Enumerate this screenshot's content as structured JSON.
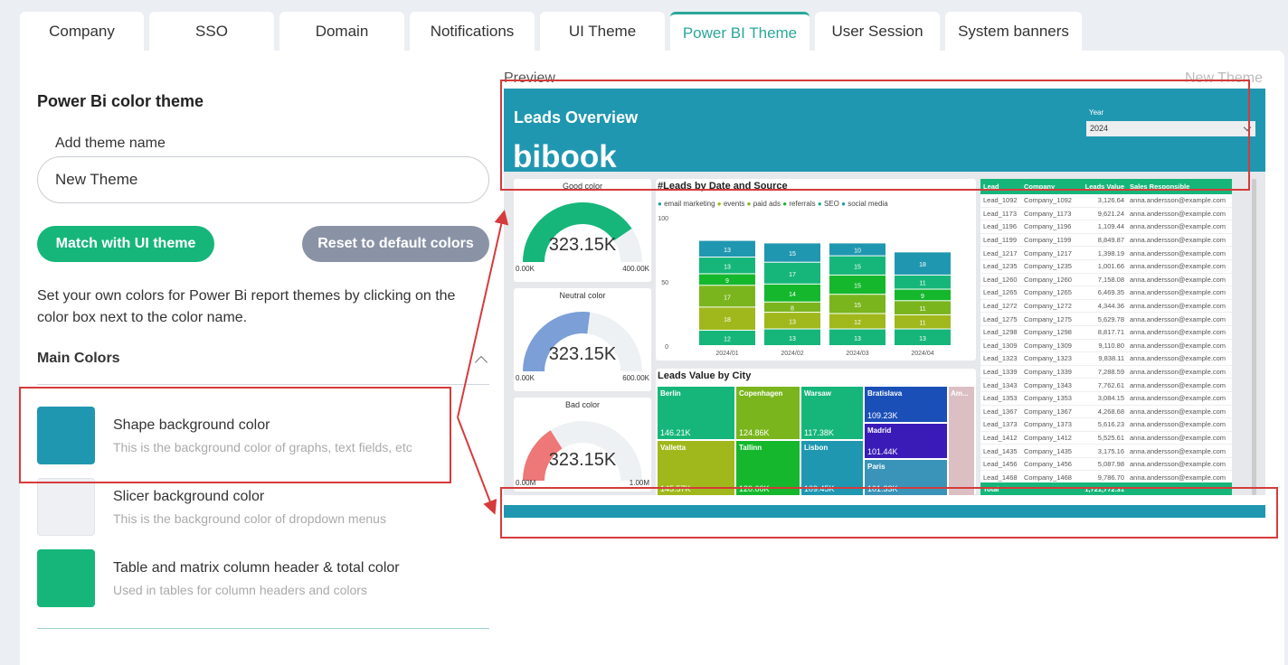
{
  "tabs": [
    {
      "label": "Company"
    },
    {
      "label": "SSO"
    },
    {
      "label": "Domain"
    },
    {
      "label": "Notifications"
    },
    {
      "label": "UI Theme"
    },
    {
      "label": "Power BI Theme"
    },
    {
      "label": "User Session"
    },
    {
      "label": "System banners"
    }
  ],
  "settings": {
    "title": "Power Bi color theme",
    "theme_name_label": "Add theme name",
    "theme_name_value": "New Theme",
    "match_button": "Match with UI theme",
    "reset_button": "Reset to default colors",
    "description": "Set your own colors for Power Bi report themes by clicking on the color box next to the color name.",
    "section_title": "Main Colors",
    "colors": [
      {
        "title": "Shape background color",
        "desc": "This is the background color of graphs, text fields, etc",
        "hex": "#2097b1"
      },
      {
        "title": "Slicer background color",
        "desc": "This is the background color of dropdown menus",
        "hex": "#eef0f3"
      },
      {
        "title": "Table and matrix column header & total color",
        "desc": "Used in tables for column headers and colors",
        "hex": "#16b67a"
      }
    ]
  },
  "preview": {
    "label": "Preview",
    "theme_name": "New Theme",
    "report_title": "Leads Overview",
    "logo": "bibook",
    "year_label": "Year",
    "year_value": "2024",
    "gauges": [
      {
        "title": "Good color",
        "value": "323.15K",
        "min": "0.00K",
        "max": "400.00K",
        "fraction": 0.81,
        "color": "#16b67a"
      },
      {
        "title": "Neutral color",
        "value": "323.15K",
        "min": "0.00K",
        "max": "600.00K",
        "fraction": 0.54,
        "color": "#7b9fd6"
      },
      {
        "title": "Bad color",
        "value": "323.15K",
        "min": "0.00M",
        "max": "1.00M",
        "fraction": 0.32,
        "color": "#ee7777"
      }
    ],
    "stacked_title": "#Leads by Date and Source",
    "legend": [
      "email marketing",
      "events",
      "paid ads",
      "referrals",
      "SEO",
      "social media"
    ],
    "treemap_title": "Leads Value by City",
    "treemap": [
      {
        "name": "Berlin",
        "value": "146.21K",
        "color": "#16b67a"
      },
      {
        "name": "Copenhagen",
        "value": "124.86K",
        "color": "#7ab51d"
      },
      {
        "name": "Warsaw",
        "value": "117.38K",
        "color": "#16b67a"
      },
      {
        "name": "Bratislava",
        "value": "109.23K",
        "color": "#1b4fb8"
      },
      {
        "name": "Am...",
        "value": "",
        "color": "#dcbfc3"
      },
      {
        "name": "Madrid",
        "value": "101.44K",
        "color": "#3a1bb8"
      },
      {
        "name": "Valletta",
        "value": "145.57K",
        "color": "#a0b81b"
      },
      {
        "name": "Tallinn",
        "value": "120.60K",
        "color": "#15b82d"
      },
      {
        "name": "Lisbon",
        "value": "109.45K",
        "color": "#2097b1"
      },
      {
        "name": "Paris",
        "value": "101.33K",
        "color": "#3a93b8"
      }
    ],
    "table": {
      "headers": [
        "Lead",
        "Company",
        "Leads Value",
        "Sales Responsible"
      ],
      "rows": [
        [
          "Lead_1092",
          "Company_1092",
          "3,126.64",
          "anna.andersson@example.com"
        ],
        [
          "Lead_1173",
          "Company_1173",
          "9,621.24",
          "anna.andersson@example.com"
        ],
        [
          "Lead_1196",
          "Company_1196",
          "1,109.44",
          "anna.andersson@example.com"
        ],
        [
          "Lead_1199",
          "Company_1199",
          "8,849.87",
          "anna.andersson@example.com"
        ],
        [
          "Lead_1217",
          "Company_1217",
          "1,398.19",
          "anna.andersson@example.com"
        ],
        [
          "Lead_1235",
          "Company_1235",
          "1,001.66",
          "anna.andersson@example.com"
        ],
        [
          "Lead_1260",
          "Company_1260",
          "7,158.08",
          "anna.andersson@example.com"
        ],
        [
          "Lead_1265",
          "Company_1265",
          "6,469.35",
          "anna.andersson@example.com"
        ],
        [
          "Lead_1272",
          "Company_1272",
          "4,344.36",
          "anna.andersson@example.com"
        ],
        [
          "Lead_1275",
          "Company_1275",
          "5,629.78",
          "anna.andersson@example.com"
        ],
        [
          "Lead_1298",
          "Company_1298",
          "8,817.71",
          "anna.andersson@example.com"
        ],
        [
          "Lead_1309",
          "Company_1309",
          "9,110.80",
          "anna.andersson@example.com"
        ],
        [
          "Lead_1323",
          "Company_1323",
          "9,838.11",
          "anna.andersson@example.com"
        ],
        [
          "Lead_1339",
          "Company_1339",
          "7,288.59",
          "anna.andersson@example.com"
        ],
        [
          "Lead_1343",
          "Company_1343",
          "7,762.61",
          "anna.andersson@example.com"
        ],
        [
          "Lead_1353",
          "Company_1353",
          "3,084.15",
          "anna.andersson@example.com"
        ],
        [
          "Lead_1367",
          "Company_1367",
          "4,268.68",
          "anna.andersson@example.com"
        ],
        [
          "Lead_1373",
          "Company_1373",
          "5,616.23",
          "anna.andersson@example.com"
        ],
        [
          "Lead_1412",
          "Company_1412",
          "5,525.61",
          "anna.andersson@example.com"
        ],
        [
          "Lead_1435",
          "Company_1435",
          "3,175.16",
          "anna.andersson@example.com"
        ],
        [
          "Lead_1456",
          "Company_1456",
          "5,087.98",
          "anna.andersson@example.com"
        ],
        [
          "Lead_1468",
          "Company_1468",
          "9,786.70",
          "anna.andersson@example.com"
        ]
      ],
      "total_label": "Total",
      "total_value": "1,721,772.31"
    }
  },
  "chart_data": {
    "type": "bar",
    "title": "#Leads by Date and Source",
    "categories": [
      "2024/01",
      "2024/02",
      "2024/03",
      "2024/04"
    ],
    "ylim": [
      0,
      100
    ],
    "yticks": [
      0,
      50,
      100
    ],
    "series": [
      {
        "name": "social media",
        "color": "#16b67a",
        "values": [
          12,
          13,
          13,
          13
        ]
      },
      {
        "name": "events",
        "color": "#a0b81b",
        "values": [
          18,
          13,
          12,
          11
        ]
      },
      {
        "name": "paid ads",
        "color": "#7ab51d",
        "values": [
          17,
          8,
          15,
          11
        ]
      },
      {
        "name": "referrals",
        "color": "#15b82d",
        "values": [
          9,
          14,
          15,
          9
        ]
      },
      {
        "name": "SEO",
        "color": "#16b67a",
        "values": [
          13,
          17,
          15,
          11
        ]
      },
      {
        "name": "email marketing",
        "color": "#2097b1",
        "values": [
          13,
          15,
          10,
          18
        ]
      }
    ]
  }
}
